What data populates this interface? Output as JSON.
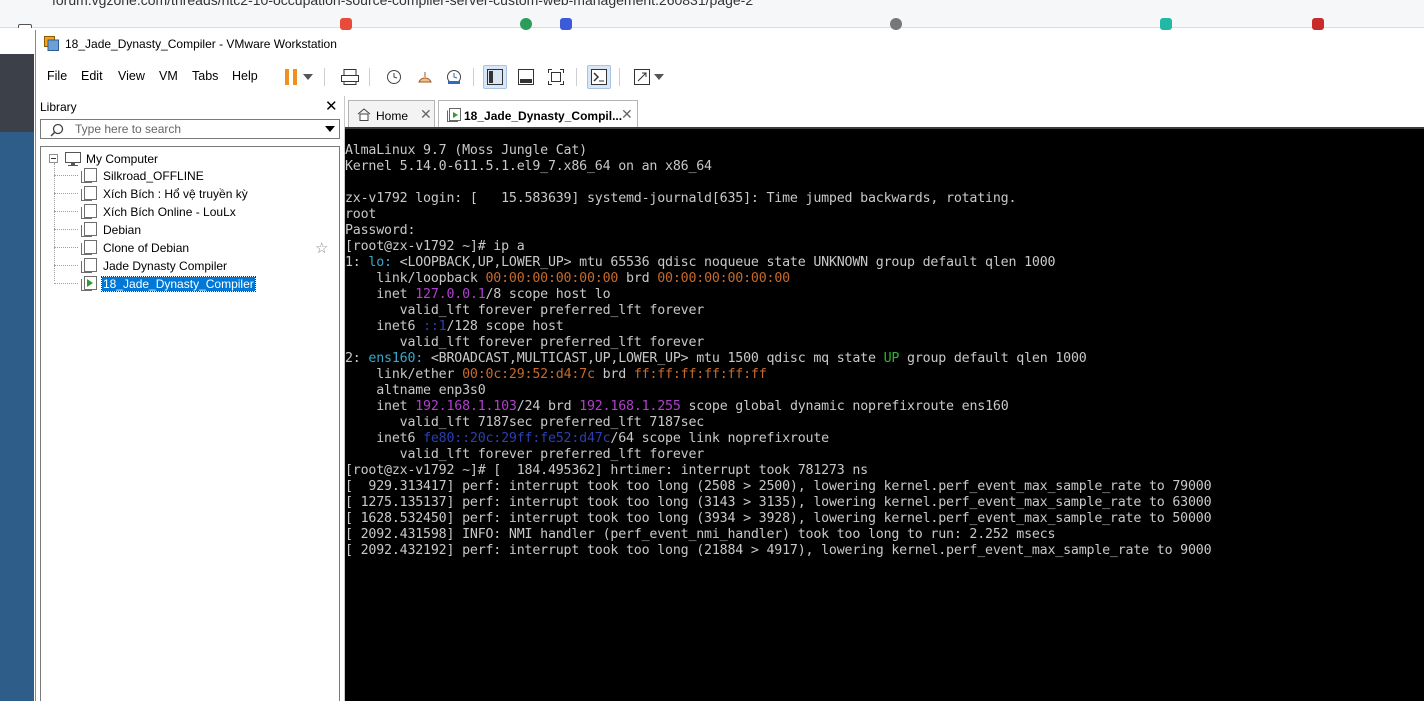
{
  "browser": {
    "url_fragment": "forum.vgzone.com/threads/ntc2-10-occupation-source-compiler-server-custom-web-management.260831/page-2"
  },
  "window": {
    "title": "18_Jade_Dynasty_Compiler - VMware Workstation"
  },
  "menu": {
    "file": "File",
    "edit": "Edit",
    "view": "View",
    "vm": "VM",
    "tabs": "Tabs",
    "help": "Help"
  },
  "toolbar": {
    "icons": [
      "pause-icon",
      "dropdown-icon",
      "send-ctrl-alt-del-icon",
      "snapshot-icon",
      "revert-snapshot-icon",
      "snapshot-manager-icon",
      "show-library-icon",
      "thumbnail-bar-icon",
      "full-screen-icon",
      "console-view-icon",
      "stretch-icon"
    ]
  },
  "library": {
    "title": "Library",
    "close": "✕",
    "search_placeholder": "Type here to search",
    "root": "My Computer",
    "items": [
      {
        "label": "Silkroad_OFFLINE",
        "selected": false,
        "running": false
      },
      {
        "label": "Xích Bích : Hổ vệ truyền kỳ",
        "selected": false,
        "running": false
      },
      {
        "label": "Xích Bích Online - LouLx",
        "selected": false,
        "running": false
      },
      {
        "label": "Debian",
        "selected": false,
        "running": false
      },
      {
        "label": "Clone of Debian",
        "selected": false,
        "running": false
      },
      {
        "label": "Jade Dynasty Compiler",
        "selected": false,
        "running": false
      },
      {
        "label": "18_Jade_Dynasty_Compiler",
        "selected": true,
        "running": true
      }
    ]
  },
  "tabs": [
    {
      "label": "Home",
      "close": "✕",
      "active": false
    },
    {
      "label": "18_Jade_Dynasty_Compil...",
      "close": "✕",
      "active": true
    }
  ],
  "console": {
    "lines": [
      [
        {
          "t": "AlmaLinux 9.7 (Moss Jungle Cat)"
        }
      ],
      [
        {
          "t": "Kernel 5.14.0-611.5.1.el9_7.x86_64 on an x86_64"
        }
      ],
      [
        {
          "t": ""
        }
      ],
      [
        {
          "t": "zx-v1792 login: [   15.583639] systemd-journald[635]: Time jumped backwards, rotating."
        }
      ],
      [
        {
          "t": "root"
        }
      ],
      [
        {
          "t": "Password:"
        }
      ],
      [
        {
          "t": "[root@zx-v1792 ~]# ip a"
        }
      ],
      [
        {
          "t": "1: "
        },
        {
          "t": "lo:",
          "c": "c-blue"
        },
        {
          "t": " <LOOPBACK,UP,LOWER_UP> mtu 65536 qdisc noqueue state UNKNOWN group default qlen 1000"
        }
      ],
      [
        {
          "t": "    link/loopback "
        },
        {
          "t": "00:00:00:00:00:00",
          "c": "c-orange"
        },
        {
          "t": " brd "
        },
        {
          "t": "00:00:00:00:00:00",
          "c": "c-orange"
        }
      ],
      [
        {
          "t": "    inet "
        },
        {
          "t": "127.0.0.1",
          "c": "c-mag"
        },
        {
          "t": "/8 scope host lo"
        }
      ],
      [
        {
          "t": "       valid_lft forever preferred_lft forever"
        }
      ],
      [
        {
          "t": "    inet6 "
        },
        {
          "t": "::1",
          "c": "c-dblue"
        },
        {
          "t": "/128 scope host"
        }
      ],
      [
        {
          "t": "       valid_lft forever preferred_lft forever"
        }
      ],
      [
        {
          "t": "2: "
        },
        {
          "t": "ens160:",
          "c": "c-blue"
        },
        {
          "t": " <BROADCAST,MULTICAST,UP,LOWER_UP> mtu 1500 qdisc mq state "
        },
        {
          "t": "UP",
          "c": "c-green"
        },
        {
          "t": " group default qlen 1000"
        }
      ],
      [
        {
          "t": "    link/ether "
        },
        {
          "t": "00:0c:29:52:d4:7c",
          "c": "c-orange"
        },
        {
          "t": " brd "
        },
        {
          "t": "ff:ff:ff:ff:ff:ff",
          "c": "c-orange"
        }
      ],
      [
        {
          "t": "    altname enp3s0"
        }
      ],
      [
        {
          "t": "    inet "
        },
        {
          "t": "192.168.1.103",
          "c": "c-mag"
        },
        {
          "t": "/24 brd "
        },
        {
          "t": "192.168.1.255",
          "c": "c-mag"
        },
        {
          "t": " scope global dynamic noprefixroute ens160"
        }
      ],
      [
        {
          "t": "       valid_lft 7187sec preferred_lft 7187sec"
        }
      ],
      [
        {
          "t": "    inet6 "
        },
        {
          "t": "fe80::20c:29ff:fe52:d47c",
          "c": "c-dblue"
        },
        {
          "t": "/64 scope link noprefixroute"
        }
      ],
      [
        {
          "t": "       valid_lft forever preferred_lft forever"
        }
      ],
      [
        {
          "t": "[root@zx-v1792 ~]# [  184.495362] hrtimer: interrupt took 781273 ns"
        }
      ],
      [
        {
          "t": "[  929.313417] perf: interrupt took too long (2508 > 2500), lowering kernel.perf_event_max_sample_rate to 79000"
        }
      ],
      [
        {
          "t": "[ 1275.135137] perf: interrupt took too long (3143 > 3135), lowering kernel.perf_event_max_sample_rate to 63000"
        }
      ],
      [
        {
          "t": "[ 1628.532450] perf: interrupt took too long (3934 > 3928), lowering kernel.perf_event_max_sample_rate to 50000"
        }
      ],
      [
        {
          "t": "[ 2092.431598] INFO: NMI handler (perf_event_nmi_handler) took too long to run: 2.252 msecs"
        }
      ],
      [
        {
          "t": "[ 2092.432192] perf: interrupt took too long (21884 > 4917), lowering kernel.perf_event_max_sample_rate to 9000"
        }
      ]
    ]
  },
  "colors": {
    "console_bg": "#000000",
    "console_text": "#c8c8c8",
    "iface_name": "#3aa6c9",
    "mac": "#c46a2d",
    "ipv4": "#b23fcf",
    "state_up": "#2fb42f",
    "ipv6": "#2b3fb0",
    "pause_orange": "#f0901e",
    "selection": "#0078d7"
  }
}
